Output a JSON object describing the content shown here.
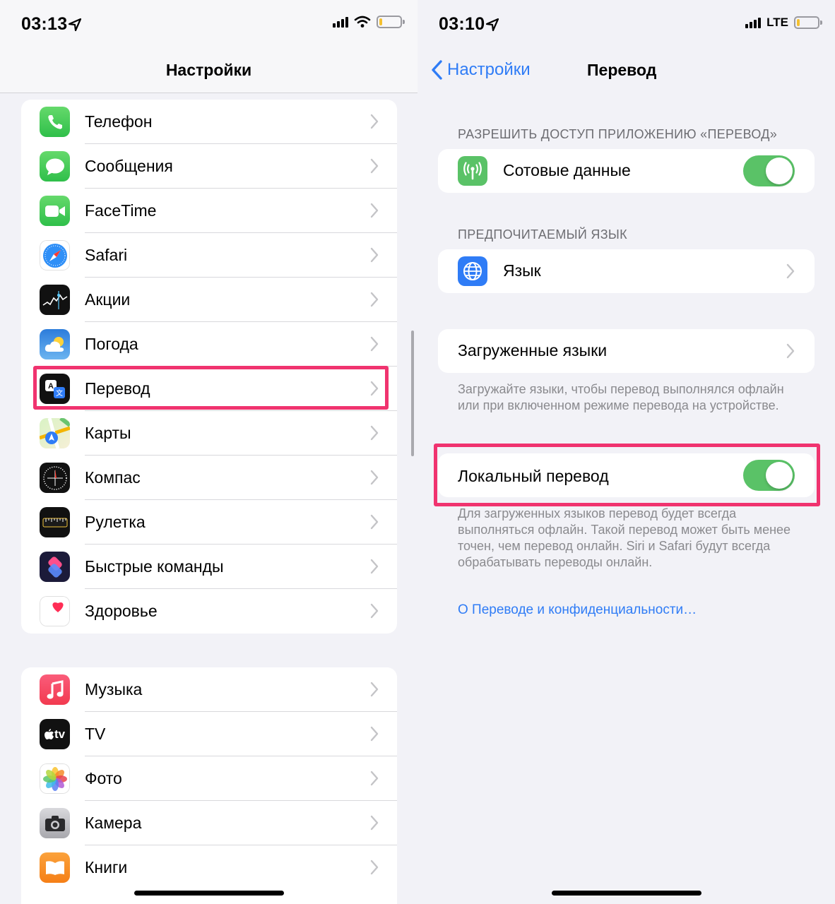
{
  "left_screen": {
    "status": {
      "time": "03:13"
    },
    "nav_title": "Настройки",
    "group1": [
      {
        "label": "Телефон",
        "icon": "phone-icon"
      },
      {
        "label": "Сообщения",
        "icon": "messages-icon"
      },
      {
        "label": "FaceTime",
        "icon": "facetime-icon"
      },
      {
        "label": "Safari",
        "icon": "safari-icon"
      },
      {
        "label": "Акции",
        "icon": "stocks-icon"
      },
      {
        "label": "Погода",
        "icon": "weather-icon"
      },
      {
        "label": "Перевод",
        "icon": "translate-icon"
      },
      {
        "label": "Карты",
        "icon": "maps-icon"
      },
      {
        "label": "Компас",
        "icon": "compass-icon"
      },
      {
        "label": "Рулетка",
        "icon": "measure-icon"
      },
      {
        "label": "Быстрые команды",
        "icon": "shortcuts-icon"
      },
      {
        "label": "Здоровье",
        "icon": "health-icon"
      }
    ],
    "group2": [
      {
        "label": "Музыка",
        "icon": "music-icon"
      },
      {
        "label": "TV",
        "icon": "tv-icon"
      },
      {
        "label": "Фото",
        "icon": "photos-icon"
      },
      {
        "label": "Камера",
        "icon": "camera-icon"
      },
      {
        "label": "Книги",
        "icon": "books-icon"
      }
    ],
    "tv_icon_text": "tv"
  },
  "right_screen": {
    "status": {
      "time": "03:10",
      "network": "LTE"
    },
    "back_label": "Настройки",
    "nav_title": "Перевод",
    "section_access": "РАЗРЕШИТЬ ДОСТУП ПРИЛОЖЕНИЮ «ПЕРЕВОД»",
    "cellular_label": "Сотовые данные",
    "cellular_on": true,
    "section_language": "ПРЕДПОЧИТАЕМЫЙ ЯЗЫК",
    "language_label": "Язык",
    "downloaded_label": "Загруженные языки",
    "downloaded_note": "Загружайте языки, чтобы перевод выполнялся офлайн или при включенном режиме перевода на устройстве.",
    "local_label": "Локальный перевод",
    "local_on": true,
    "local_note": "Для загруженных языков перевод будет всегда выполняться офлайн. Такой перевод может быть менее точен, чем перевод онлайн. Siri и Safari будут всегда обрабатывать переводы онлайн.",
    "privacy_link": "О Переводе и конфиденциальности…"
  },
  "colors": {
    "accent": "#2f7cf6",
    "toggle_on": "#5ac267",
    "highlight": "#f0336f"
  }
}
